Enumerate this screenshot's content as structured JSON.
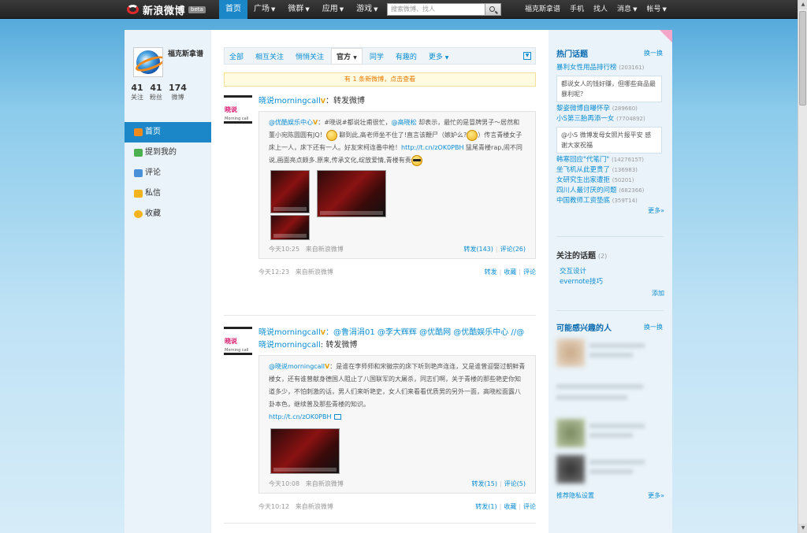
{
  "topbar": {
    "logo_text": "新浪微博",
    "beta": "beta",
    "nav": [
      {
        "label": "首页",
        "active": true,
        "caret": false
      },
      {
        "label": "广场",
        "active": false,
        "caret": true
      },
      {
        "label": "微群",
        "active": false,
        "caret": true
      },
      {
        "label": "应用",
        "active": false,
        "caret": true
      },
      {
        "label": "游戏",
        "active": false,
        "caret": true
      }
    ],
    "search_placeholder": "搜索微博、找人",
    "right_nav": [
      {
        "label": "福克斯拿谱",
        "caret": false
      },
      {
        "label": "手机",
        "caret": false
      },
      {
        "label": "找人",
        "caret": false
      },
      {
        "label": "消息",
        "caret": true
      },
      {
        "label": "帐号",
        "caret": true
      }
    ]
  },
  "profile": {
    "name": "福克斯拿谱",
    "stats": [
      {
        "num": "41",
        "label": "关注"
      },
      {
        "num": "41",
        "label": "粉丝"
      },
      {
        "num": "174",
        "label": "微博"
      }
    ]
  },
  "side_menu": [
    {
      "label": "首页",
      "active": true,
      "icon": "home-icon",
      "color": "#f08a1c"
    },
    {
      "label": "提到我的",
      "active": false,
      "icon": "at-icon",
      "color": "#4caf50"
    },
    {
      "label": "评论",
      "active": false,
      "icon": "comment-icon",
      "color": "#4a90d9"
    },
    {
      "label": "私信",
      "active": false,
      "icon": "mail-icon",
      "color": "#f2b31c"
    },
    {
      "label": "收藏",
      "active": false,
      "icon": "star-icon",
      "color": "#f2b31c"
    }
  ],
  "tabs": [
    "全部",
    "相互关注",
    "悄悄关注",
    "官方",
    "同学",
    "有趣的",
    "更多"
  ],
  "active_tab_index": 3,
  "newbar": "有 1 条新微博，点击查看",
  "posts": [
    {
      "avatar_brand": "晓说",
      "avatar_sub": "Morning call",
      "author": "晓说morningcall",
      "verified": "V",
      "text": "：转发微博",
      "quote": {
        "author": "@优酷娱乐中心",
        "verified": "V",
        "text1": "：#晓说#都说壮甫很忙，",
        "mention": "@高晓松",
        "text2": " 却表示，最忙的是冒牌男子～居然和董小宛陈圆圆有JQ！",
        "text3": " 聊到此,高老师坐不住了!直言该鞭尸（嫉妒么?",
        "text4": "）传言青楼女子床上一人，床下还有一人。好友宋柯连番中枪！",
        "link": "http://t.cn/zOK0PBH",
        "text5": " 猛尾青楼rap,闹不同说,画面亮点颇多.原来,传承文化,绽放爱情,青楼有责",
        "time": "今天10:25",
        "source": "来自新浪微博",
        "repost": "转发(143)",
        "comment": "评论(26)"
      },
      "time": "今天12:23",
      "source": "来自新浪微博",
      "actions": [
        "转发",
        "收藏",
        "评论"
      ]
    },
    {
      "avatar_brand": "晓说",
      "avatar_sub": "Morning call",
      "author": "晓说morningcall",
      "verified": "V",
      "text": "：@鲁涓涓01 @李大辉辉 @优酷网 @优酷娱乐中心 //@",
      "text_line2_author": "晓说morningcall",
      "text_line2": ": 转发微博",
      "quote": {
        "author": "@晓说morningcall",
        "verified": "V",
        "text": "：是谁在李师师和宋徽宗的床下听到艳声连连，又是谁曾迎娶过朝鲜青楼女，还有谁曾献身德国人阻止了八国联军的大屠杀，同志们啊，关于青楼的那些艳史你知道多少，不怕刺激的话，男人们来听艳史，女人们来看看优质男的另外一面，高晓松面露八卦本色，继续普及那些青楼的知识。",
        "link": "http://t.cn/zOK0PBH",
        "time": "今天10:08",
        "source": "来自新浪微博",
        "repost": "转发(15)",
        "comment": "评论(5)"
      },
      "time": "今天10:12",
      "source": "来自新浪微博",
      "actions": [
        "转发(1)",
        "收藏",
        "评论"
      ]
    }
  ],
  "hot_topics": {
    "title": "热门话题",
    "action": "换一换",
    "items": [
      {
        "label": "暴利女性用品排行榜",
        "count": "(203161)",
        "box": "都说女人的钱好赚，但哪些商品最暴利呢？"
      },
      {
        "label": "黎姿微博自曝怀孕",
        "count": "(289660)",
        "box": ""
      },
      {
        "label": "小S第三胎再添一女",
        "count": "(7704892)",
        "box": "@小S 微博发母女照片报平安 感谢大家祝福"
      },
      {
        "label": "韩寒回应\"代笔门\"",
        "count": "(1427615T)",
        "box": ""
      },
      {
        "label": "坐飞机从此更贵了",
        "count": "(136983)",
        "box": ""
      },
      {
        "label": "女研究生出家遭拒",
        "count": "(50201)",
        "box": ""
      },
      {
        "label": "四川人最讨厌的问题",
        "count": "(682366)",
        "box": ""
      },
      {
        "label": "中国教师工资垫底",
        "count": "(359T14)",
        "box": ""
      }
    ],
    "more": "更多»"
  },
  "followed_topics": {
    "title": "关注的话题",
    "count": "(2)",
    "items": [
      "交互设计",
      "evernote技巧"
    ],
    "add": "添加"
  },
  "interested": {
    "title": "可能感兴趣的人",
    "action": "换一换",
    "settings": "推荐隐私设置",
    "more": "更多»"
  }
}
